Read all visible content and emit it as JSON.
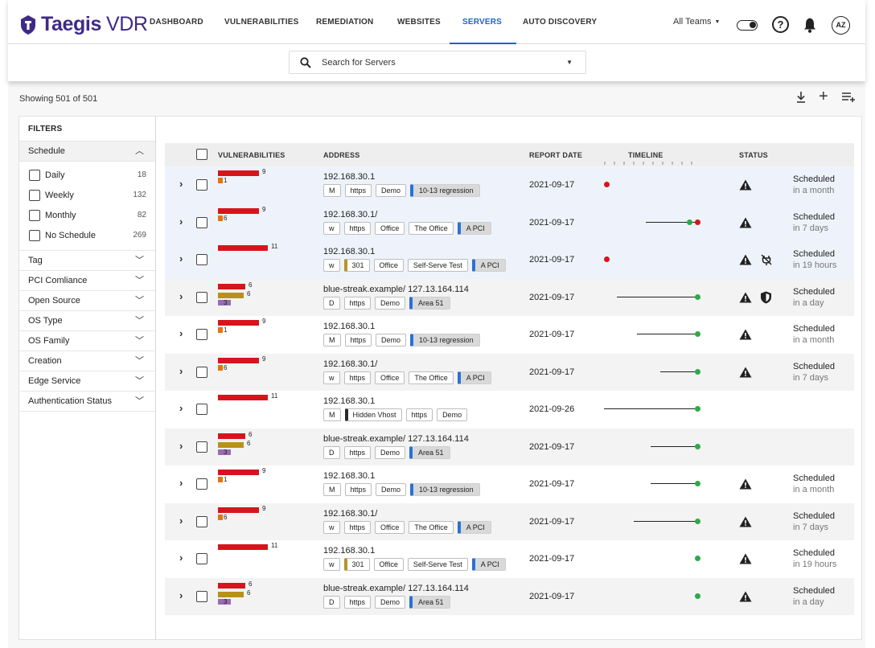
{
  "app": {
    "brand": "Taegis",
    "product": "VDR"
  },
  "nav": {
    "tabs": [
      {
        "label": "DASHBOARD",
        "active": false
      },
      {
        "label": "VULNERABILITIES",
        "active": false
      },
      {
        "label": "REMEDIATION",
        "active": false
      },
      {
        "label": "WEBSITES",
        "active": false
      },
      {
        "label": "SERVERS",
        "active": true
      },
      {
        "label": "AUTO DISCOVERY",
        "active": false
      }
    ],
    "team_selector": "All Teams",
    "avatar_initials": "AZ"
  },
  "search": {
    "placeholder": "Search for Servers"
  },
  "summary": {
    "showing": "Showing 501 of 501"
  },
  "filters": {
    "title": "FILTERS",
    "schedule": {
      "label": "Schedule",
      "options": [
        {
          "label": "Daily",
          "count": "18"
        },
        {
          "label": "Weekly",
          "count": "132"
        },
        {
          "label": "Monthly",
          "count": "82"
        },
        {
          "label": "No Schedule",
          "count": "269"
        }
      ]
    },
    "sections": [
      "Tag",
      "PCI Comliance",
      "Open Source",
      "OS Type",
      "OS Family",
      "Creation",
      "Edge Service",
      "Authentication Status"
    ]
  },
  "table": {
    "headers": {
      "vulnerabilities": "VULNERABILITIES",
      "address": "ADDRESS",
      "report_date": "REPORT DATE",
      "timeline": "TIMELINE",
      "status": "STATUS"
    },
    "colors": {
      "critical": "#d7141c",
      "high": "#e8720c",
      "medium": "#b8901c",
      "low": "#9a6bb0",
      "tag_accent": "#2b71d4",
      "dot_red": "#d7141c",
      "dot_green": "#2eaa48"
    },
    "rows": [
      {
        "bg": "blue",
        "vulns": [
          {
            "sev": "critical",
            "count": "9"
          },
          {
            "sev": "high",
            "count": "1"
          }
        ],
        "address": "192.168.30.1",
        "tags": [
          {
            "text": "M",
            "style": "plain"
          },
          {
            "text": "https",
            "style": "plain"
          },
          {
            "text": "Demo",
            "style": "plain"
          },
          {
            "text": "10-13 regression",
            "style": "hl"
          }
        ],
        "report_date": "2021-09-17",
        "timeline": {
          "line_from": null,
          "red_dot": true,
          "green_dot": false
        },
        "status": {
          "warn": true,
          "extra": null,
          "label": "Scheduled",
          "sub": "in a month"
        }
      },
      {
        "bg": "blue",
        "vulns": [
          {
            "sev": "critical",
            "count": "9"
          },
          {
            "sev": "high",
            "count": "6"
          }
        ],
        "address": "192.168.30.1/",
        "tags": [
          {
            "text": "w",
            "style": "plain"
          },
          {
            "text": "https",
            "style": "plain"
          },
          {
            "text": "Office",
            "style": "plain"
          },
          {
            "text": "The Office",
            "style": "plain"
          },
          {
            "text": "A PCI",
            "style": "hl"
          }
        ],
        "report_date": "2021-09-17",
        "timeline": {
          "line_from": 0.45,
          "red_dot": true,
          "green_dot": true
        },
        "status": {
          "warn": true,
          "extra": null,
          "label": "Scheduled",
          "sub": "in 7 days"
        }
      },
      {
        "bg": "blue",
        "vulns": [
          {
            "sev": "critical",
            "count": "11"
          }
        ],
        "address": "192.168.30.1",
        "tags": [
          {
            "text": "w",
            "style": "plain"
          },
          {
            "text": "301",
            "style": "gold"
          },
          {
            "text": "Office",
            "style": "plain"
          },
          {
            "text": "Self-Serve Test",
            "style": "plain"
          },
          {
            "text": "A PCI",
            "style": "hl"
          }
        ],
        "report_date": "2021-09-17",
        "timeline": {
          "line_from": null,
          "red_dot": true,
          "green_dot": false
        },
        "status": {
          "warn": true,
          "extra": "plug-off-icon",
          "label": "Scheduled",
          "sub": "in 19 hours"
        }
      },
      {
        "bg": "gray",
        "vulns": [
          {
            "sev": "critical",
            "count": "6"
          },
          {
            "sev": "medium",
            "count": "6"
          },
          {
            "sev": "low",
            "count": "3"
          }
        ],
        "address": "blue-streak.example/ 127.13.164.114",
        "tags": [
          {
            "text": "D",
            "style": "plain"
          },
          {
            "text": "https",
            "style": "plain"
          },
          {
            "text": "Demo",
            "style": "plain"
          },
          {
            "text": "Area 51",
            "style": "hl"
          }
        ],
        "report_date": "2021-09-17",
        "timeline": {
          "line_from": 0.14,
          "red_dot": false,
          "green_dot": true
        },
        "status": {
          "warn": true,
          "extra": "shield-icon",
          "label": "Scheduled",
          "sub": "in a day"
        }
      },
      {
        "bg": "white",
        "vulns": [
          {
            "sev": "critical",
            "count": "9"
          },
          {
            "sev": "high",
            "count": "1"
          }
        ],
        "address": "192.168.30.1",
        "tags": [
          {
            "text": "M",
            "style": "plain"
          },
          {
            "text": "https",
            "style": "plain"
          },
          {
            "text": "Demo",
            "style": "plain"
          },
          {
            "text": "10-13 regression",
            "style": "hl"
          }
        ],
        "report_date": "2021-09-17",
        "timeline": {
          "line_from": 0.35,
          "red_dot": false,
          "green_dot": true
        },
        "status": {
          "warn": true,
          "extra": null,
          "label": "Scheduled",
          "sub": "in a month"
        }
      },
      {
        "bg": "gray",
        "vulns": [
          {
            "sev": "critical",
            "count": "9"
          },
          {
            "sev": "high",
            "count": "6"
          }
        ],
        "address": "192.168.30.1/",
        "tags": [
          {
            "text": "w",
            "style": "plain"
          },
          {
            "text": "https",
            "style": "plain"
          },
          {
            "text": "Office",
            "style": "plain"
          },
          {
            "text": "The Office",
            "style": "plain"
          },
          {
            "text": "A PCI",
            "style": "hl"
          }
        ],
        "report_date": "2021-09-17",
        "timeline": {
          "line_from": 0.6,
          "red_dot": false,
          "green_dot": true
        },
        "status": {
          "warn": true,
          "extra": null,
          "label": "Scheduled",
          "sub": "in 7 days"
        }
      },
      {
        "bg": "white",
        "vulns": [
          {
            "sev": "critical",
            "count": "11"
          }
        ],
        "address": "192.168.30.1",
        "tags": [
          {
            "text": "M",
            "style": "plain"
          },
          {
            "text": "Hidden Vhost",
            "style": "dark"
          },
          {
            "text": "https",
            "style": "plain"
          },
          {
            "text": "Demo",
            "style": "plain"
          }
        ],
        "report_date": "2021-09-26",
        "timeline": {
          "line_from": 0.0,
          "red_dot": false,
          "green_dot": true
        },
        "status": {
          "warn": false,
          "extra": null,
          "label": "",
          "sub": ""
        }
      },
      {
        "bg": "gray",
        "vulns": [
          {
            "sev": "critical",
            "count": "6"
          },
          {
            "sev": "medium",
            "count": "6"
          },
          {
            "sev": "low",
            "count": "3"
          }
        ],
        "address": "blue-streak.example/  127.13.164.114",
        "tags": [
          {
            "text": "D",
            "style": "plain"
          },
          {
            "text": "https",
            "style": "plain"
          },
          {
            "text": "Demo",
            "style": "plain"
          },
          {
            "text": "Area 51",
            "style": "hl"
          }
        ],
        "report_date": "2021-09-17",
        "timeline": {
          "line_from": 0.5,
          "red_dot": false,
          "green_dot": true
        },
        "status": {
          "warn": false,
          "extra": null,
          "label": "",
          "sub": ""
        }
      },
      {
        "bg": "white",
        "vulns": [
          {
            "sev": "critical",
            "count": "9"
          },
          {
            "sev": "high",
            "count": "1"
          }
        ],
        "address": "192.168.30.1",
        "tags": [
          {
            "text": "M",
            "style": "plain"
          },
          {
            "text": "https",
            "style": "plain"
          },
          {
            "text": "Demo",
            "style": "plain"
          },
          {
            "text": "10-13 regression",
            "style": "hl"
          }
        ],
        "report_date": "2021-09-17",
        "timeline": {
          "line_from": 0.5,
          "red_dot": false,
          "green_dot": true
        },
        "status": {
          "warn": true,
          "extra": null,
          "label": "Scheduled",
          "sub": "in a month"
        }
      },
      {
        "bg": "gray",
        "vulns": [
          {
            "sev": "critical",
            "count": "9"
          },
          {
            "sev": "high",
            "count": "6"
          }
        ],
        "address": "192.168.30.1/",
        "tags": [
          {
            "text": "w",
            "style": "plain"
          },
          {
            "text": "https",
            "style": "plain"
          },
          {
            "text": "Office",
            "style": "plain"
          },
          {
            "text": "The Office",
            "style": "plain"
          },
          {
            "text": "A PCI",
            "style": "hl"
          }
        ],
        "report_date": "2021-09-17",
        "timeline": {
          "line_from": 0.32,
          "red_dot": false,
          "green_dot": true
        },
        "status": {
          "warn": true,
          "extra": null,
          "label": "Scheduled",
          "sub": "in 7 days"
        }
      },
      {
        "bg": "white",
        "vulns": [
          {
            "sev": "critical",
            "count": "11"
          }
        ],
        "address": "192.168.30.1",
        "tags": [
          {
            "text": "w",
            "style": "plain"
          },
          {
            "text": "301",
            "style": "gold"
          },
          {
            "text": "Office",
            "style": "plain"
          },
          {
            "text": "Self-Serve Test",
            "style": "plain"
          },
          {
            "text": "A PCI",
            "style": "hl"
          }
        ],
        "report_date": "2021-09-17",
        "timeline": {
          "line_from": null,
          "red_dot": false,
          "green_dot": true
        },
        "status": {
          "warn": true,
          "extra": null,
          "label": "Scheduled",
          "sub": "in 19 hours"
        }
      },
      {
        "bg": "gray",
        "vulns": [
          {
            "sev": "critical",
            "count": "6"
          },
          {
            "sev": "medium",
            "count": "6"
          },
          {
            "sev": "low",
            "count": "3"
          }
        ],
        "address": "blue-streak.example/  127.13.164.114",
        "tags": [
          {
            "text": "D",
            "style": "plain"
          },
          {
            "text": "https",
            "style": "plain"
          },
          {
            "text": "Demo",
            "style": "plain"
          },
          {
            "text": "Area 51",
            "style": "hl"
          }
        ],
        "report_date": "2021-09-17",
        "timeline": {
          "line_from": null,
          "red_dot": false,
          "green_dot": true
        },
        "status": {
          "warn": true,
          "extra": null,
          "label": "Scheduled",
          "sub": "in a day"
        }
      }
    ]
  }
}
